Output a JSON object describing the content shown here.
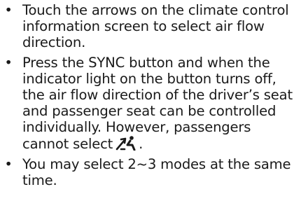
{
  "bullets": [
    {
      "marker": "•",
      "text": "Touch the arrows on the climate control information screen to select air flow direction."
    },
    {
      "marker": "•",
      "text": "Press the SYNC button and when the indicator light on the button turns off, the air flow direction of the driver’s seat and passenger seat can be controlled individually. However, passengers cannot select",
      "trailing_icon": "seated-person-airflow-icon",
      "trailing_text": "."
    },
    {
      "marker": "•",
      "text": "You may select 2~3 modes at the same time."
    }
  ]
}
